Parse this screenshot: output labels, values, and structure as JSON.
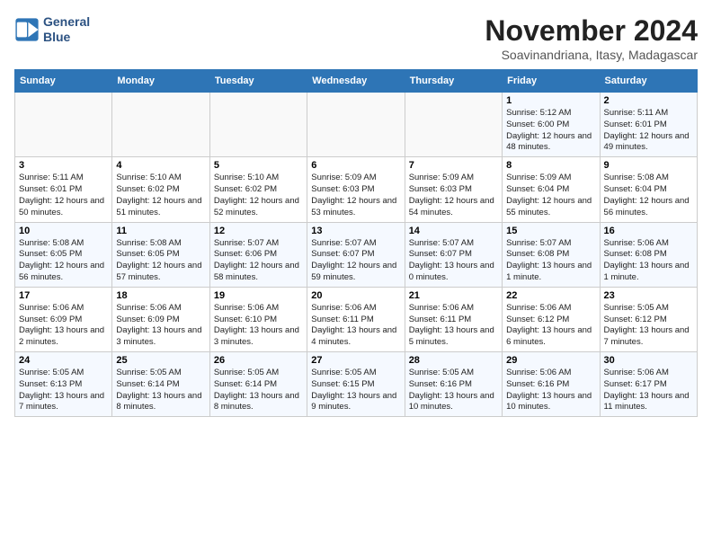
{
  "header": {
    "logo_line1": "General",
    "logo_line2": "Blue",
    "title": "November 2024",
    "subtitle": "Soavinandriana, Itasy, Madagascar"
  },
  "weekdays": [
    "Sunday",
    "Monday",
    "Tuesday",
    "Wednesday",
    "Thursday",
    "Friday",
    "Saturday"
  ],
  "weeks": [
    [
      {
        "day": "",
        "info": ""
      },
      {
        "day": "",
        "info": ""
      },
      {
        "day": "",
        "info": ""
      },
      {
        "day": "",
        "info": ""
      },
      {
        "day": "",
        "info": ""
      },
      {
        "day": "1",
        "info": "Sunrise: 5:12 AM\nSunset: 6:00 PM\nDaylight: 12 hours and 48 minutes."
      },
      {
        "day": "2",
        "info": "Sunrise: 5:11 AM\nSunset: 6:01 PM\nDaylight: 12 hours and 49 minutes."
      }
    ],
    [
      {
        "day": "3",
        "info": "Sunrise: 5:11 AM\nSunset: 6:01 PM\nDaylight: 12 hours and 50 minutes."
      },
      {
        "day": "4",
        "info": "Sunrise: 5:10 AM\nSunset: 6:02 PM\nDaylight: 12 hours and 51 minutes."
      },
      {
        "day": "5",
        "info": "Sunrise: 5:10 AM\nSunset: 6:02 PM\nDaylight: 12 hours and 52 minutes."
      },
      {
        "day": "6",
        "info": "Sunrise: 5:09 AM\nSunset: 6:03 PM\nDaylight: 12 hours and 53 minutes."
      },
      {
        "day": "7",
        "info": "Sunrise: 5:09 AM\nSunset: 6:03 PM\nDaylight: 12 hours and 54 minutes."
      },
      {
        "day": "8",
        "info": "Sunrise: 5:09 AM\nSunset: 6:04 PM\nDaylight: 12 hours and 55 minutes."
      },
      {
        "day": "9",
        "info": "Sunrise: 5:08 AM\nSunset: 6:04 PM\nDaylight: 12 hours and 56 minutes."
      }
    ],
    [
      {
        "day": "10",
        "info": "Sunrise: 5:08 AM\nSunset: 6:05 PM\nDaylight: 12 hours and 56 minutes."
      },
      {
        "day": "11",
        "info": "Sunrise: 5:08 AM\nSunset: 6:05 PM\nDaylight: 12 hours and 57 minutes."
      },
      {
        "day": "12",
        "info": "Sunrise: 5:07 AM\nSunset: 6:06 PM\nDaylight: 12 hours and 58 minutes."
      },
      {
        "day": "13",
        "info": "Sunrise: 5:07 AM\nSunset: 6:07 PM\nDaylight: 12 hours and 59 minutes."
      },
      {
        "day": "14",
        "info": "Sunrise: 5:07 AM\nSunset: 6:07 PM\nDaylight: 13 hours and 0 minutes."
      },
      {
        "day": "15",
        "info": "Sunrise: 5:07 AM\nSunset: 6:08 PM\nDaylight: 13 hours and 1 minute."
      },
      {
        "day": "16",
        "info": "Sunrise: 5:06 AM\nSunset: 6:08 PM\nDaylight: 13 hours and 1 minute."
      }
    ],
    [
      {
        "day": "17",
        "info": "Sunrise: 5:06 AM\nSunset: 6:09 PM\nDaylight: 13 hours and 2 minutes."
      },
      {
        "day": "18",
        "info": "Sunrise: 5:06 AM\nSunset: 6:09 PM\nDaylight: 13 hours and 3 minutes."
      },
      {
        "day": "19",
        "info": "Sunrise: 5:06 AM\nSunset: 6:10 PM\nDaylight: 13 hours and 3 minutes."
      },
      {
        "day": "20",
        "info": "Sunrise: 5:06 AM\nSunset: 6:11 PM\nDaylight: 13 hours and 4 minutes."
      },
      {
        "day": "21",
        "info": "Sunrise: 5:06 AM\nSunset: 6:11 PM\nDaylight: 13 hours and 5 minutes."
      },
      {
        "day": "22",
        "info": "Sunrise: 5:06 AM\nSunset: 6:12 PM\nDaylight: 13 hours and 6 minutes."
      },
      {
        "day": "23",
        "info": "Sunrise: 5:05 AM\nSunset: 6:12 PM\nDaylight: 13 hours and 7 minutes."
      }
    ],
    [
      {
        "day": "24",
        "info": "Sunrise: 5:05 AM\nSunset: 6:13 PM\nDaylight: 13 hours and 7 minutes."
      },
      {
        "day": "25",
        "info": "Sunrise: 5:05 AM\nSunset: 6:14 PM\nDaylight: 13 hours and 8 minutes."
      },
      {
        "day": "26",
        "info": "Sunrise: 5:05 AM\nSunset: 6:14 PM\nDaylight: 13 hours and 8 minutes."
      },
      {
        "day": "27",
        "info": "Sunrise: 5:05 AM\nSunset: 6:15 PM\nDaylight: 13 hours and 9 minutes."
      },
      {
        "day": "28",
        "info": "Sunrise: 5:05 AM\nSunset: 6:16 PM\nDaylight: 13 hours and 10 minutes."
      },
      {
        "day": "29",
        "info": "Sunrise: 5:06 AM\nSunset: 6:16 PM\nDaylight: 13 hours and 10 minutes."
      },
      {
        "day": "30",
        "info": "Sunrise: 5:06 AM\nSunset: 6:17 PM\nDaylight: 13 hours and 11 minutes."
      }
    ]
  ]
}
